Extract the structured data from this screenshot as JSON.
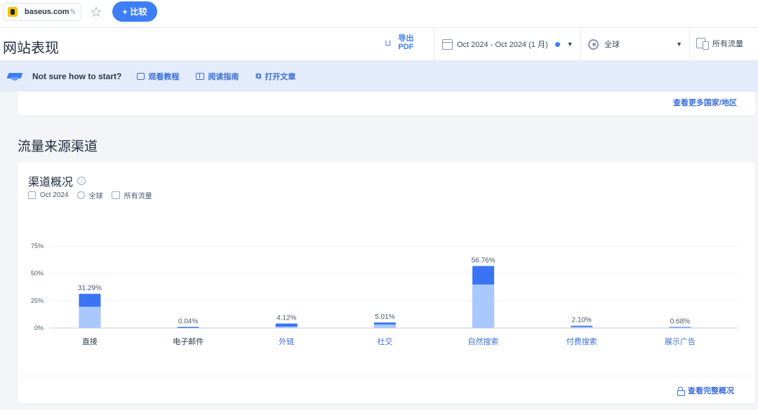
{
  "topbar": {
    "domain": "baseus.com",
    "compare_label": "比较",
    "compare_icon": "+"
  },
  "header": {
    "title": "网站表现",
    "export_label": "导出 PDF",
    "date_range": "Oct 2024 - Oct 2024 (1 月)",
    "region": "全球",
    "traffic": "所有流量"
  },
  "helpbar": {
    "question": "Not sure how to start?",
    "links": [
      "观看教程",
      "阅读指南",
      "打开文章"
    ]
  },
  "countries_card": {
    "more_link": "查看更多国家/地区"
  },
  "section": {
    "title": "流量来源渠道"
  },
  "channel_card": {
    "title": "渠道概况",
    "meta_date": "Oct 2024",
    "meta_region": "全球",
    "meta_traffic": "所有流量",
    "footer_link": "查看完整概况"
  },
  "colors": {
    "accent": "#3d7ef7",
    "bar_dark": "#3a74f4",
    "bar_light": "#a9c8fd",
    "link": "#3d6fd6"
  },
  "chart_data": {
    "type": "bar",
    "categories": [
      "直接",
      "电子邮件",
      "外链",
      "社交",
      "自然搜索",
      "付费搜索",
      "展示广告"
    ],
    "values": [
      31.29,
      0.04,
      4.12,
      5.01,
      56.76,
      2.1,
      0.68
    ],
    "value_labels": [
      "31.29%",
      "0.04%",
      "4.12%",
      "5.01%",
      "56.76%",
      "2.10%",
      "0.68%"
    ],
    "light_values": [
      19.5,
      0.04,
      1.3,
      3.2,
      39.8,
      1.1,
      0.4
    ],
    "y_ticks": [
      0,
      25,
      50,
      75
    ],
    "y_tick_labels": [
      "0%",
      "25%",
      "50%",
      "75%"
    ],
    "ylim": [
      0,
      75
    ],
    "linked_categories": [
      false,
      false,
      true,
      true,
      true,
      true,
      true
    ],
    "grid": true
  }
}
